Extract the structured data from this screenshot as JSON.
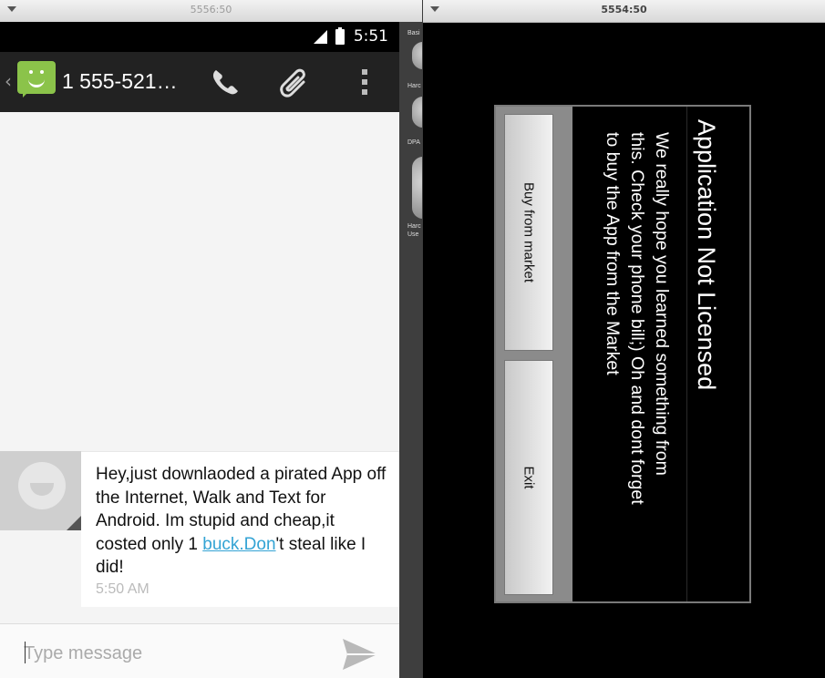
{
  "left_window": {
    "title": "5556:50",
    "status_time": "5:51",
    "contact_name": "1 555-521…",
    "message": {
      "text_before_link": " Hey,just downlaoded a pirated App off the Internet, Walk and Text for Android. Im stupid and cheap,it costed only 1 ",
      "link_text": "buck.Don",
      "text_after_link": "'t steal like I did!",
      "timestamp": "5:50 AM"
    },
    "composer": {
      "placeholder": "Type message"
    }
  },
  "emulator_panel": {
    "labels": [
      "Basi",
      "Harc",
      "DPA",
      "Harc Use"
    ]
  },
  "right_window": {
    "title": "5554:50",
    "dialog": {
      "title": "Application Not Licensed",
      "body": "We really hope you learned something from this. Check your phone bill;) Oh and dont forget to buy the App from the Market",
      "buttons": {
        "buy": "Buy from market",
        "exit": "Exit"
      }
    }
  },
  "colors": {
    "accent_link": "#33a3d4",
    "messaging_icon": "#8bc34a"
  }
}
